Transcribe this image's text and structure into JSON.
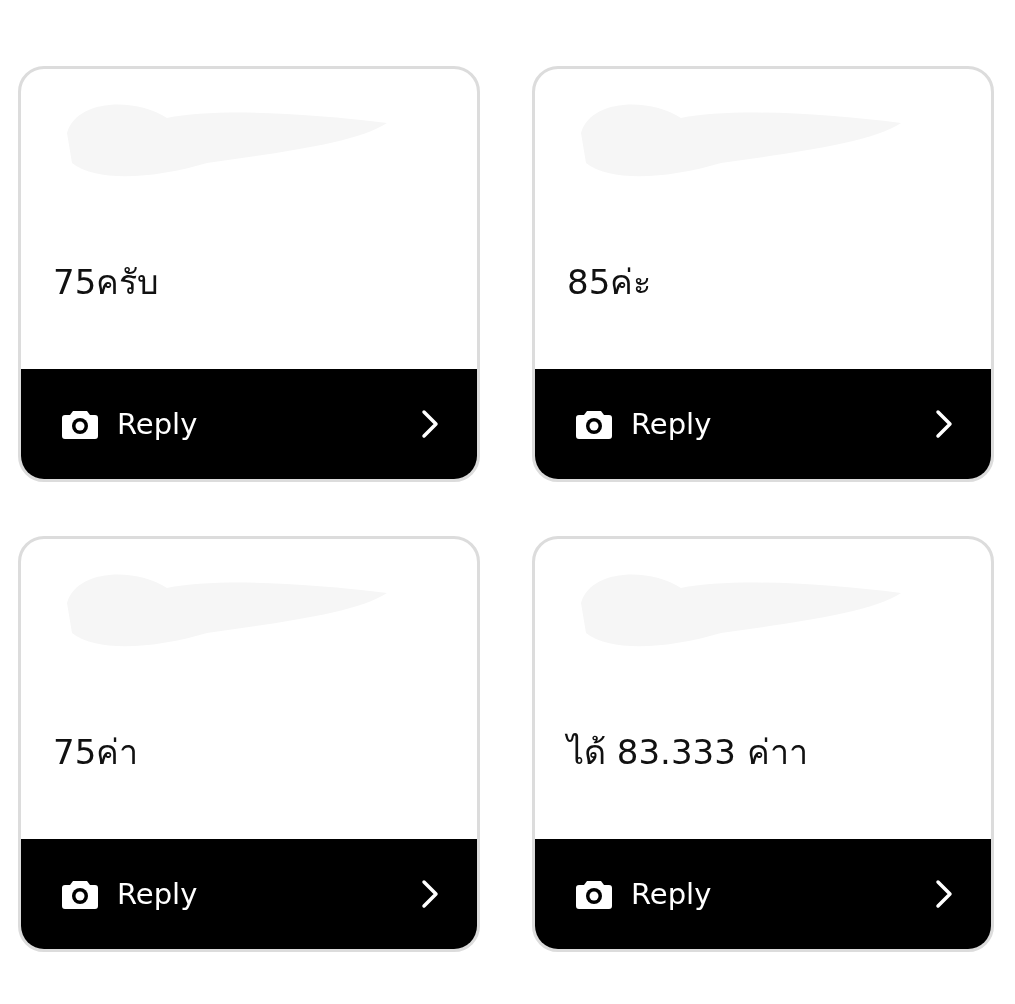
{
  "cards": [
    {
      "message": "75ครับ",
      "reply_label": "Reply"
    },
    {
      "message": "85ค่ะ",
      "reply_label": "Reply"
    },
    {
      "message": "75ค่า",
      "reply_label": "Reply"
    },
    {
      "message": "ได้ 83.333 ค่าา",
      "reply_label": "Reply"
    }
  ]
}
